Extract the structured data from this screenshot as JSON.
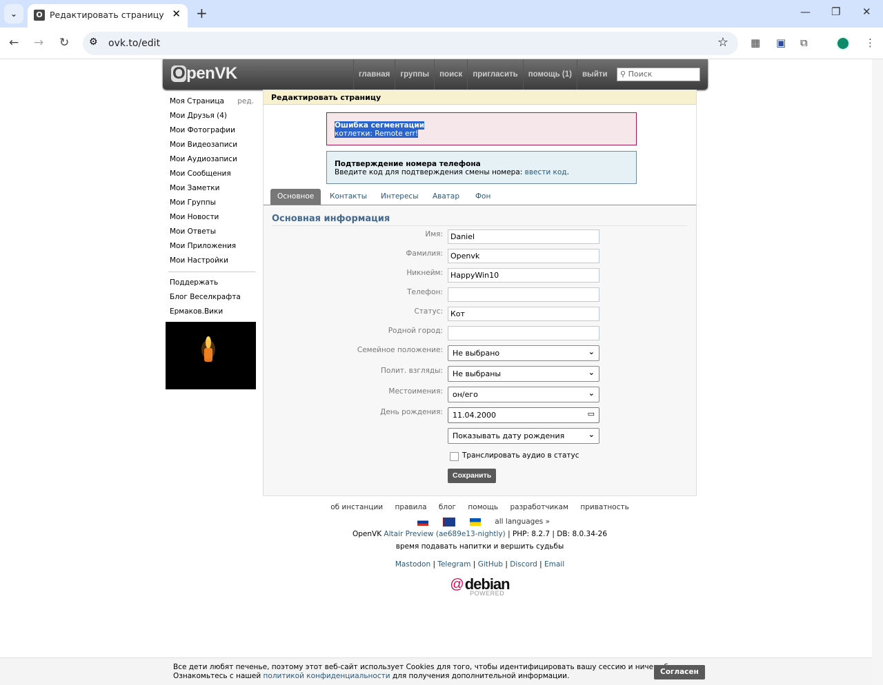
{
  "browser": {
    "tab_title": "Редактировать страницу - OpenVK",
    "tab_favicon": "O",
    "url": "ovk.to/edit"
  },
  "header": {
    "logo": "OpenVK",
    "logo_initial": "O",
    "logo_rest": "penVK",
    "menu": [
      "главная",
      "группы",
      "поиск",
      "пригласить",
      "помощь (1)",
      "выйти"
    ],
    "search_placeholder": "Поиск"
  },
  "sidebar": {
    "items": [
      "Моя Страница",
      "Мои Друзья (4)",
      "Мои Фотографии",
      "Мои Видеозаписи",
      "Мои Аудиозаписи",
      "Мои Сообщения",
      "Мои Заметки",
      "Мои Группы",
      "Мои Новости",
      "Мои Ответы",
      "Мои Приложения",
      "Мои Настройки"
    ],
    "edit_label": "ред.",
    "extra": [
      "Поддержать",
      "Блог Веселкрафта",
      "Ермаков.Вики"
    ]
  },
  "main": {
    "title": "Редактировать страницу",
    "error": {
      "title": "Ошибка сегментации",
      "text": "котлетки: Remote err!"
    },
    "info": {
      "title": "Подтверждение номера телефона",
      "text": "Введите код для подтверждения смены номера: ",
      "link": "ввести код",
      "end": "."
    },
    "tabs": [
      "Основное",
      "Контакты",
      "Интересы",
      "Аватар",
      "Фон"
    ],
    "section_title": "Основная информация",
    "fields": [
      {
        "label": "Имя:",
        "value": "Daniel"
      },
      {
        "label": "Фамилия:",
        "value": "Openvk"
      },
      {
        "label": "Никнейм:",
        "value": "HappyWin10"
      },
      {
        "label": "Телефон:",
        "value": ""
      },
      {
        "label": "Статус:",
        "value": "Кот"
      },
      {
        "label": "Родной город:",
        "value": ""
      }
    ],
    "selects": [
      {
        "label": "Семейное положение:",
        "value": "Не выбрано"
      },
      {
        "label": "Полит. взгляды:",
        "value": "Не выбраны"
      },
      {
        "label": "Местоимения:",
        "value": "он/его"
      }
    ],
    "birthday": {
      "label": "День рождения:",
      "value": "11.04.2000",
      "visibility": "Показывать дату рождения"
    },
    "checkbox_label": "Транслировать аудио в статус",
    "save": "Сохранить"
  },
  "footer": {
    "links": [
      "об инстанции",
      "правила",
      "блог",
      "помощь",
      "разработчикам",
      "приватность"
    ],
    "all_languages": "all languages »",
    "version_prefix": "OpenVK ",
    "version_link": "Altair Preview (ae689e13-nightly)",
    "version_suffix": " | PHP: 8.2.7 | DB: 8.0.34-26",
    "slogan": "время подавать напитки и вершить судьбы",
    "social": [
      "Mastodon",
      "Telegram",
      "GitHub",
      "Discord",
      "Email"
    ],
    "badge": "debian POWERED"
  },
  "cookie": {
    "line1": "Все дети любят печенье, поэтому этот веб-сайт использует Cookies для того, чтобы идентифицировать вашу сессию и ничего более.",
    "line2_pre": "Ознакомьтесь с нашей ",
    "line2_link": "политикой конфиденциальности",
    "line2_post": " для получения дополнительной информации.",
    "agree": "Согласен"
  }
}
